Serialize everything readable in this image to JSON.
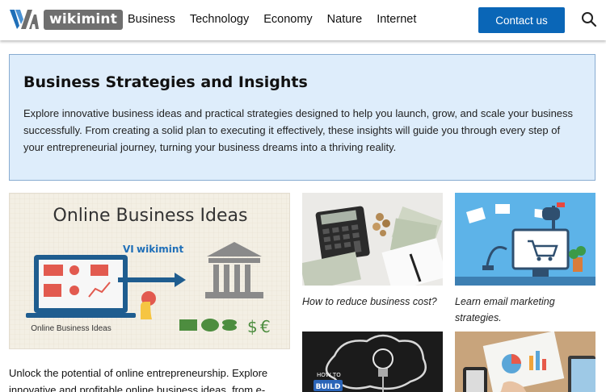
{
  "header": {
    "logo_text": "wikimint",
    "nav": [
      "Business",
      "Technology",
      "Economy",
      "Nature",
      "Internet"
    ],
    "contact_label": "Contact us"
  },
  "intro": {
    "title": "Business Strategies and Insights",
    "body": "Explore innovative business ideas and practical strategies designed to help you launch, grow, and scale your business successfully. From creating a solid plan to executing it effectively, these insights will guide you through every step of your entrepreneurial journey, turning your business dreams into a thriving reality."
  },
  "featured": {
    "image_title": "Online Business Ideas",
    "image_logo": "wikimint",
    "image_caption": "Online Business Ideas",
    "excerpt": "Unlock the potential of online entrepreneurship. Explore innovative and profitable online business ideas, from e-"
  },
  "cards": [
    {
      "caption": "How to reduce business cost?"
    },
    {
      "caption": "Learn email marketing strategies."
    },
    {
      "caption": ""
    },
    {
      "caption": ""
    }
  ],
  "card3_overlay": {
    "line1": "HOW TO",
    "line2": "BUILD"
  },
  "colors": {
    "brand_blue": "#0a66b7",
    "intro_bg": "#deedfb",
    "intro_border": "#88acd1"
  }
}
